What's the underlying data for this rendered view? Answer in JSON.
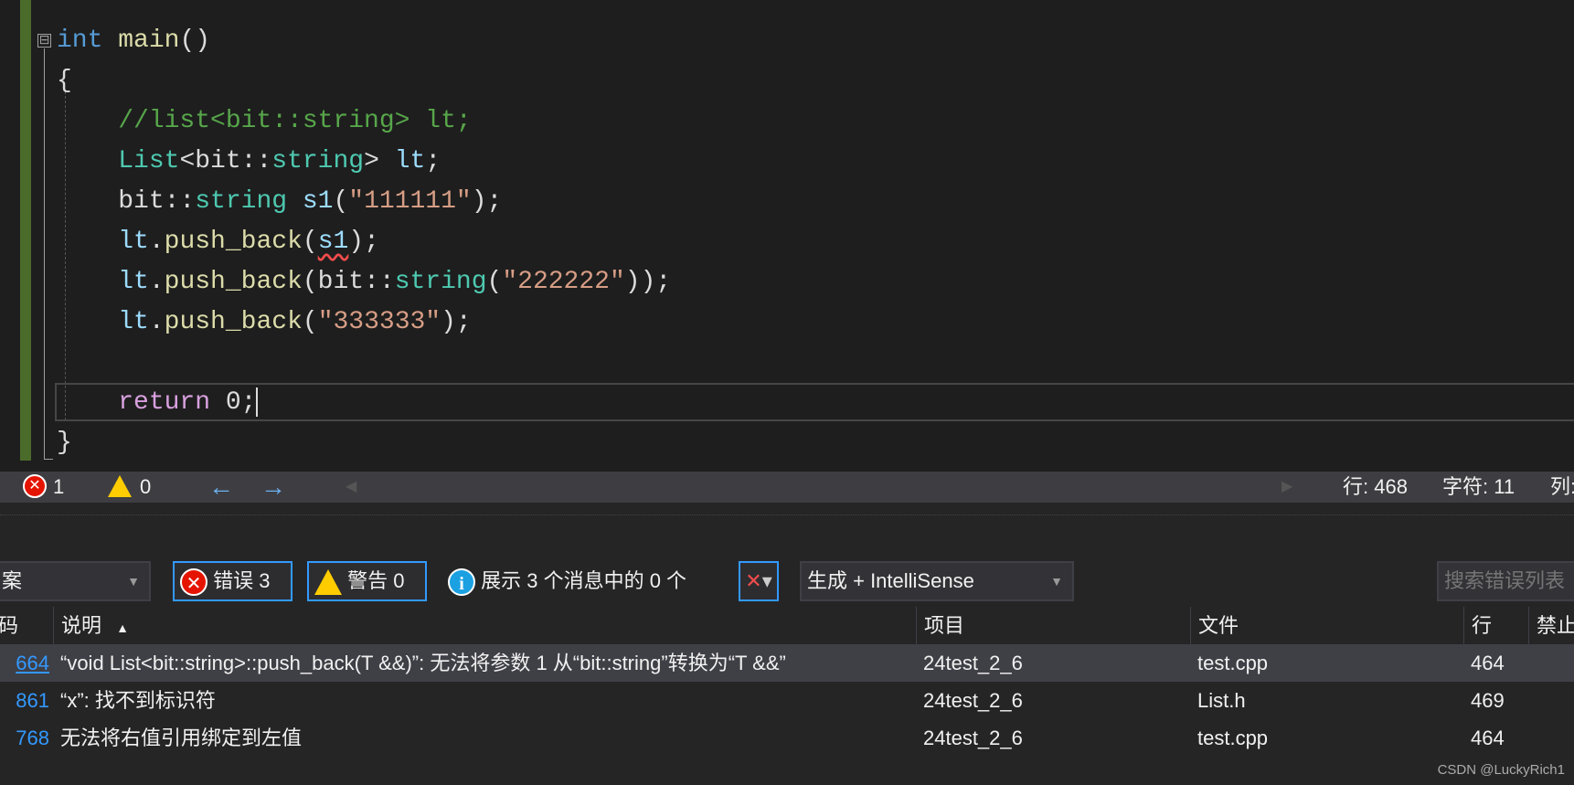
{
  "editor": {
    "lines": [
      [
        {
          "t": "int",
          "c": "kw"
        },
        {
          "t": " main",
          "c": "fn"
        },
        {
          "t": "()",
          "c": "pl"
        }
      ],
      [
        {
          "t": "{",
          "c": "pl"
        }
      ],
      [
        {
          "t": "    //list<bit::string> lt;",
          "c": "cm"
        }
      ],
      [
        {
          "t": "    ",
          "c": "pl"
        },
        {
          "t": "List",
          "c": "ty"
        },
        {
          "t": "<bit::",
          "c": "pl"
        },
        {
          "t": "string",
          "c": "ty"
        },
        {
          "t": "> ",
          "c": "pl"
        },
        {
          "t": "lt",
          "c": "vr"
        },
        {
          "t": ";",
          "c": "pl"
        }
      ],
      [
        {
          "t": "    bit::",
          "c": "pl"
        },
        {
          "t": "string",
          "c": "ty"
        },
        {
          "t": " ",
          "c": "pl"
        },
        {
          "t": "s1",
          "c": "vr"
        },
        {
          "t": "(",
          "c": "pl"
        },
        {
          "t": "\"111111\"",
          "c": "st"
        },
        {
          "t": ");",
          "c": "pl"
        }
      ],
      [
        {
          "t": "    ",
          "c": "pl"
        },
        {
          "t": "lt",
          "c": "vr"
        },
        {
          "t": ".",
          "c": "pl"
        },
        {
          "t": "push_back",
          "c": "fn"
        },
        {
          "t": "(",
          "c": "pl"
        },
        {
          "t": "s1",
          "c": "vr squig"
        },
        {
          "t": ");",
          "c": "pl"
        }
      ],
      [
        {
          "t": "    ",
          "c": "pl"
        },
        {
          "t": "lt",
          "c": "vr"
        },
        {
          "t": ".",
          "c": "pl"
        },
        {
          "t": "push_back",
          "c": "fn"
        },
        {
          "t": "(bit::",
          "c": "pl"
        },
        {
          "t": "string",
          "c": "ty"
        },
        {
          "t": "(",
          "c": "pl"
        },
        {
          "t": "\"222222\"",
          "c": "st"
        },
        {
          "t": "));",
          "c": "pl"
        }
      ],
      [
        {
          "t": "    ",
          "c": "pl"
        },
        {
          "t": "lt",
          "c": "vr"
        },
        {
          "t": ".",
          "c": "pl"
        },
        {
          "t": "push_back",
          "c": "fn"
        },
        {
          "t": "(",
          "c": "pl"
        },
        {
          "t": "\"333333\"",
          "c": "st"
        },
        {
          "t": ");",
          "c": "pl"
        }
      ],
      [],
      [
        {
          "t": "    ",
          "c": "pl"
        },
        {
          "t": "return",
          "c": "rt"
        },
        {
          "t": " 0;",
          "c": "pl"
        }
      ],
      [
        {
          "t": "}",
          "c": "pl"
        }
      ]
    ],
    "fold_glyph": "⊟"
  },
  "status": {
    "errors": "1",
    "warnings": "0",
    "line": "行: 468",
    "char": "字符: 11",
    "col": "列:"
  },
  "toolbar": {
    "scope": "案",
    "errors_label": "错误 3",
    "warnings_label": "警告 0",
    "info_label": "展示 3 个消息中的 0 个",
    "build_filter": "生成 + IntelliSense",
    "search_placeholder": "搜索错误列表"
  },
  "table": {
    "headers": [
      "码",
      "说明",
      "项目",
      "文件",
      "行",
      "禁止"
    ],
    "sort_indicator": "▲",
    "rows": [
      {
        "code": "664",
        "desc": "“void List<bit::string>::push_back(T &&)”: 无法将参数 1 从“bit::string”转换为“T &&”",
        "project": "24test_2_6",
        "file": "test.cpp",
        "line": "464",
        "selected": true
      },
      {
        "code": "861",
        "desc": "“x”: 找不到标识符",
        "project": "24test_2_6",
        "file": "List.h",
        "line": "469"
      },
      {
        "code": "768",
        "desc": "无法将右值引用绑定到左值",
        "project": "24test_2_6",
        "file": "test.cpp",
        "line": "464"
      }
    ]
  },
  "watermark": "CSDN @LuckyRich1"
}
